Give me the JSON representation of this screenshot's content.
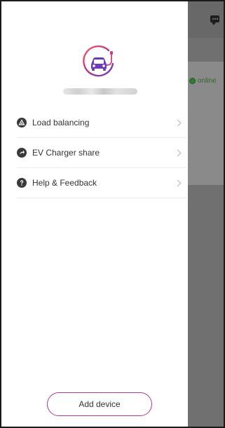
{
  "underlay": {
    "status_text": "online",
    "status_color": "#2e7d32",
    "chat_icon": "chat-bubble-icon"
  },
  "drawer": {
    "logo_icon": "ev-charger-car-icon",
    "brand_gradient": [
      "#ff5d5d",
      "#b3378a",
      "#6a3db8"
    ],
    "menu": [
      {
        "label": "Load balancing",
        "icon": "load-balance-icon"
      },
      {
        "label": "EV Charger share",
        "icon": "share-icon"
      },
      {
        "label": "Help & Feedback",
        "icon": "help-icon"
      }
    ],
    "add_device_label": "Add device"
  }
}
